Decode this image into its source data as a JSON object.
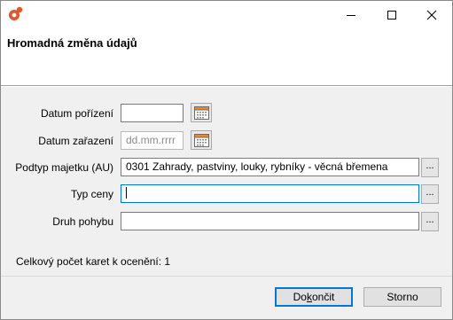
{
  "window": {
    "header_title": "Hromadná změna údajů"
  },
  "icons": {
    "app": "app-logo-icon",
    "minimize": "minimize-icon",
    "maximize": "maximize-icon",
    "close": "close-icon",
    "calendar": "calendar-icon"
  },
  "form": {
    "datum_porizeni": {
      "label": "Datum pořízení",
      "value": ""
    },
    "datum_zarazeni": {
      "label": "Datum zařazení",
      "value": "",
      "placeholder": "dd.mm.rrrr"
    },
    "podtyp_majetku": {
      "label": "Podtyp majetku (AU)",
      "value": "0301 Zahrady, pastviny, louky, rybníky - věcná břemena"
    },
    "typ_ceny": {
      "label": "Typ ceny",
      "value": ""
    },
    "druh_pohybu": {
      "label": "Druh pohybu",
      "value": ""
    },
    "browse_label": "..."
  },
  "summary": "Celkový počet karet k ocenění: 1",
  "buttons": {
    "finish": "Dokončit",
    "finish_accesskey_prefix": "Do",
    "finish_accesskey": "k",
    "finish_accesskey_suffix": "ončit",
    "cancel": "Storno"
  },
  "colors": {
    "accent": "#0078d7",
    "app_icon_primary": "#e1562b"
  }
}
